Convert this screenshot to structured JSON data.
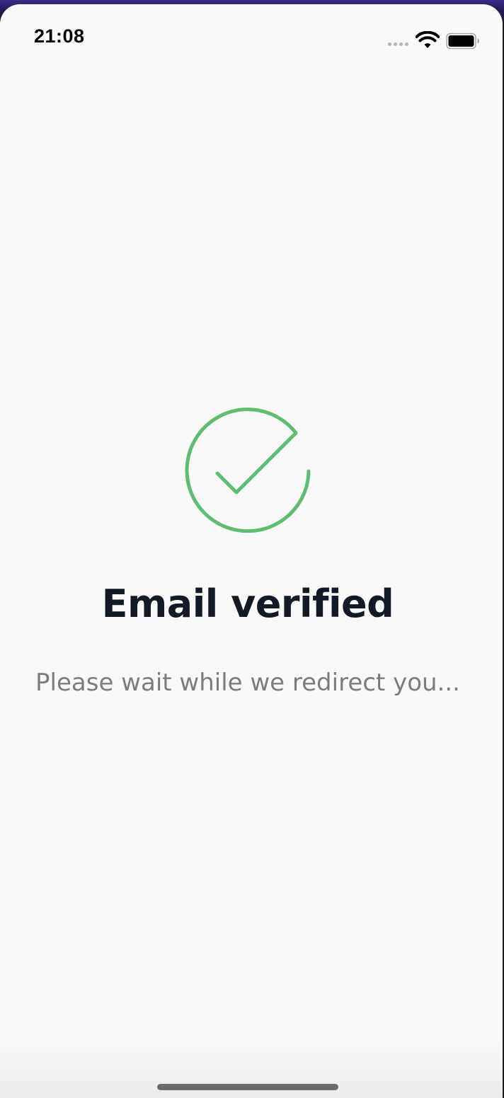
{
  "status_bar": {
    "time": "21:08"
  },
  "verification": {
    "title": "Email verified",
    "message": "Please wait while we redirect you..."
  },
  "icons": {
    "status": "check-circle-icon",
    "wifi": "wifi-icon",
    "battery": "battery-icon",
    "signal": "signal-icon"
  },
  "colors": {
    "success": "#5dbf6e",
    "title": "#111a26",
    "subtitle": "#7c7c7c",
    "background": "#f9f9f9"
  }
}
